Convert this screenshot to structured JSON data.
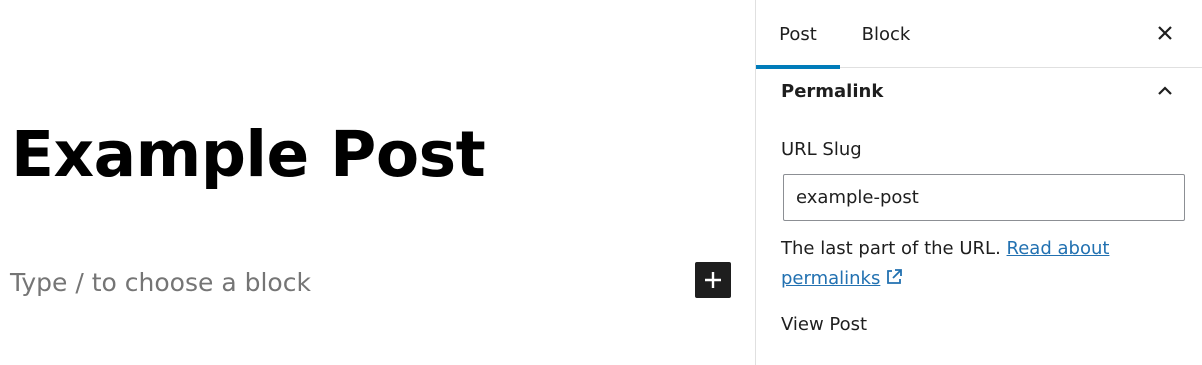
{
  "editor": {
    "title": "Example Post",
    "block_placeholder": "Type / to choose a block",
    "inserter_icon": "plus-icon"
  },
  "sidebar": {
    "tabs": [
      {
        "label": "Post",
        "active": true
      },
      {
        "label": "Block",
        "active": false
      }
    ],
    "close_icon": "close-icon",
    "accent_color": "#007cba",
    "permalink_panel": {
      "title": "Permalink",
      "toggle_icon": "chevron-up-icon",
      "url_slug_label": "URL Slug",
      "url_slug_value": "example-post",
      "help_text": "The last part of the URL.",
      "help_link_text": "Read about permalinks",
      "external_link_icon": "external-link-icon",
      "link_color": "#2271b1",
      "view_post_label": "View Post"
    }
  }
}
